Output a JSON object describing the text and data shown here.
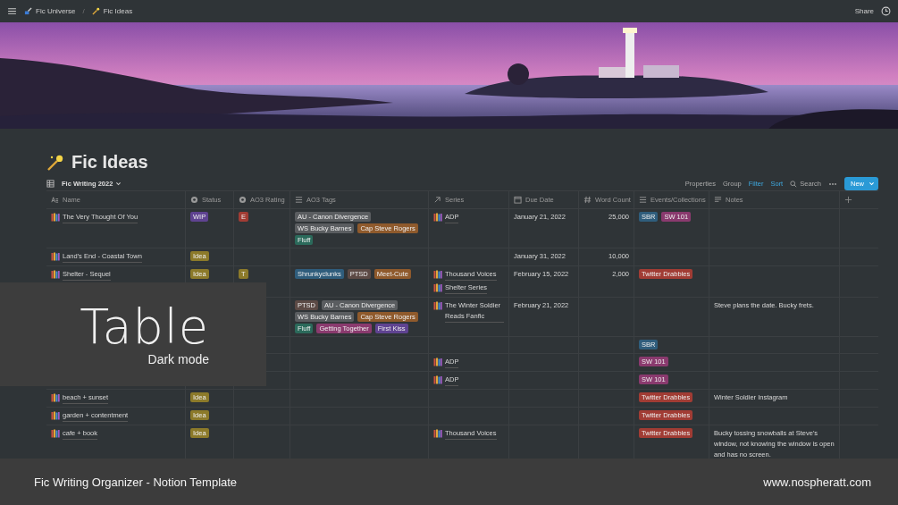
{
  "topbar": {
    "breadcrumbs": [
      {
        "label": "Fic Universe"
      },
      {
        "label": "Fic Ideas"
      }
    ],
    "separator": "/",
    "share": "Share"
  },
  "page": {
    "title": "Fic Ideas"
  },
  "view": {
    "name": "Fic Writing 2022",
    "actions": [
      {
        "label": "Properties",
        "active": false
      },
      {
        "label": "Group",
        "active": false
      },
      {
        "label": "Filter",
        "active": true
      },
      {
        "label": "Sort",
        "active": true
      }
    ],
    "search": "Search",
    "new_button": "New"
  },
  "table": {
    "columns": [
      {
        "label": "Name",
        "kind": "title"
      },
      {
        "label": "Status",
        "kind": "status"
      },
      {
        "label": "AO3 Rating",
        "kind": "status"
      },
      {
        "label": "AO3 Tags",
        "kind": "list"
      },
      {
        "label": "Series",
        "kind": "relation"
      },
      {
        "label": "Due Date",
        "kind": "date"
      },
      {
        "label": "Word Count",
        "kind": "number"
      },
      {
        "label": "Events/Collections",
        "kind": "list"
      },
      {
        "label": "Notes",
        "kind": "text"
      },
      {
        "kind": "add"
      }
    ],
    "rows": [
      {
        "name": "The Very Thought Of You",
        "status": {
          "label": "WIP",
          "color": "#5f4391"
        },
        "rating": {
          "label": "E",
          "color": "#a13c34"
        },
        "tags": [
          {
            "label": "AU - Canon Divergence",
            "color": "#5a5d60"
          },
          {
            "label": "WS Bucky Barnes",
            "color": "#5a5d60"
          },
          {
            "label": "Cap Steve Rogers",
            "color": "#8f5a2c"
          },
          {
            "label": "Fluff",
            "color": "#2b6a5b"
          }
        ],
        "series": [
          {
            "label": "ADP"
          }
        ],
        "due": "January 21, 2022",
        "words": "25,000",
        "events": [
          {
            "label": "SBR",
            "color": "#2f5d7c"
          },
          {
            "label": "SW 101",
            "color": "#8a3a6e"
          }
        ]
      },
      {
        "name": "Land's End - Coastal Town",
        "status": {
          "label": "Idea",
          "color": "#8c7a2a"
        },
        "due": "January 31, 2022",
        "words": "10,000"
      },
      {
        "name": "Shelter - Sequel",
        "status": {
          "label": "Idea",
          "color": "#8c7a2a"
        },
        "rating": {
          "label": "T",
          "color": "#8c7a2a"
        },
        "tags": [
          {
            "label": "Shrunkyclunks",
            "color": "#2f5d7c"
          },
          {
            "label": "PTSD",
            "color": "#5c4a45"
          },
          {
            "label": "Meet-Cute",
            "color": "#8f5a2c"
          }
        ],
        "series": [
          {
            "label": "Thousand Voices"
          },
          {
            "label": "Shelter Series"
          }
        ],
        "due": "February 15, 2022",
        "words": "2,000",
        "events": [
          {
            "label": "Twitter Drabbles",
            "color": "#a13c34"
          }
        ]
      },
      {
        "tags": [
          {
            "label": "PTSD",
            "color": "#5c4a45"
          },
          {
            "label": "AU - Canon Divergence",
            "color": "#5a5d60"
          },
          {
            "label": "WS Bucky Barnes",
            "color": "#5a5d60"
          },
          {
            "label": "Cap Steve Rogers",
            "color": "#8f5a2c"
          },
          {
            "label": "Fluff",
            "color": "#2b6a5b"
          },
          {
            "label": "Getting Together",
            "color": "#8a3a6e"
          },
          {
            "label": "First Kiss",
            "color": "#5f4391"
          }
        ],
        "series": [
          {
            "label": "The Winter Soldier Reads Fanfic"
          }
        ],
        "due": "February 21, 2022",
        "notes": "Steve plans the date. Bucky frets."
      },
      {
        "events": [
          {
            "label": "SBR",
            "color": "#2f5d7c"
          }
        ]
      },
      {
        "series": [
          {
            "label": "ADP"
          }
        ],
        "events": [
          {
            "label": "SW 101",
            "color": "#8a3a6e"
          }
        ]
      },
      {
        "series": [
          {
            "label": "ADP"
          }
        ],
        "events": [
          {
            "label": "SW 101",
            "color": "#8a3a6e"
          }
        ]
      },
      {
        "name": "beach + sunset",
        "status": {
          "label": "Idea",
          "color": "#8c7a2a"
        },
        "events": [
          {
            "label": "Twitter Drabbles",
            "color": "#a13c34"
          }
        ],
        "notes": "Winter Soldier Instagram"
      },
      {
        "name": "garden + contentment",
        "status": {
          "label": "Idea",
          "color": "#8c7a2a"
        },
        "events": [
          {
            "label": "Twitter Drabbles",
            "color": "#a13c34"
          }
        ]
      },
      {
        "name": "cafe + book",
        "status": {
          "label": "Idea",
          "color": "#8c7a2a"
        },
        "series": [
          {
            "label": "Thousand Voices"
          }
        ],
        "events": [
          {
            "label": "Twitter Drabbles",
            "color": "#a13c34"
          }
        ],
        "notes": "Bucky tossing snowballs at Steve's window, not knowing the window is open and has no screen."
      }
    ]
  },
  "overlay": {
    "title": "Table",
    "subtitle": "Dark mode"
  },
  "footer": {
    "left": "Fic Writing Organizer - Notion Template",
    "right": "www.nospheratt.com"
  }
}
